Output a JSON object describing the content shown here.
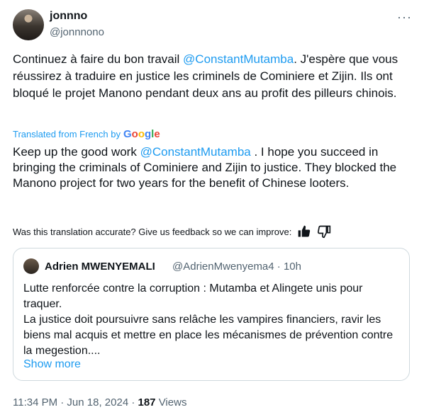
{
  "author": {
    "name": "jonnno",
    "handle": "@jonnnono"
  },
  "tweet": {
    "text_before": "Continuez à faire du bon travail ",
    "mention": "@ConstantMutamba",
    "text_after": ". J'espère que vous réussirez à traduire en justice les criminels de Cominiere et Zijin. Ils ont bloqué le projet Manono pendant deux ans au profit des pilleurs chinois."
  },
  "translation": {
    "label": "Translated from French by",
    "text_before": "Keep up the good work ",
    "mention": "@ConstantMutamba",
    "text_after": " . I hope you succeed in bringing the criminals of Cominiere and Zijin to justice. They blocked the Manono project for two years for the benefit of Chinese looters.",
    "feedback": "Was this translation accurate? Give us feedback so we can improve:"
  },
  "quote": {
    "name": "Adrien MWENYEMALI",
    "handle": "@AdrienMwenyema4 · 10h",
    "text": "Lutte renforcée contre la corruption : Mutamba et Alingete unis pour traquer.\nLa justice doit poursuivre sans relâche les vampires financiers, ravir les biens mal acquis et mettre en place les mécanismes de prévention contre la megestion....",
    "show_more": "Show more"
  },
  "meta": {
    "time": "11:34 PM · Jun 18, 2024 · ",
    "views_count": "187",
    "views_label": " Views"
  },
  "icons": [
    "more-icon",
    "thumbs-up-icon",
    "thumbs-down-icon",
    "google-logo"
  ]
}
